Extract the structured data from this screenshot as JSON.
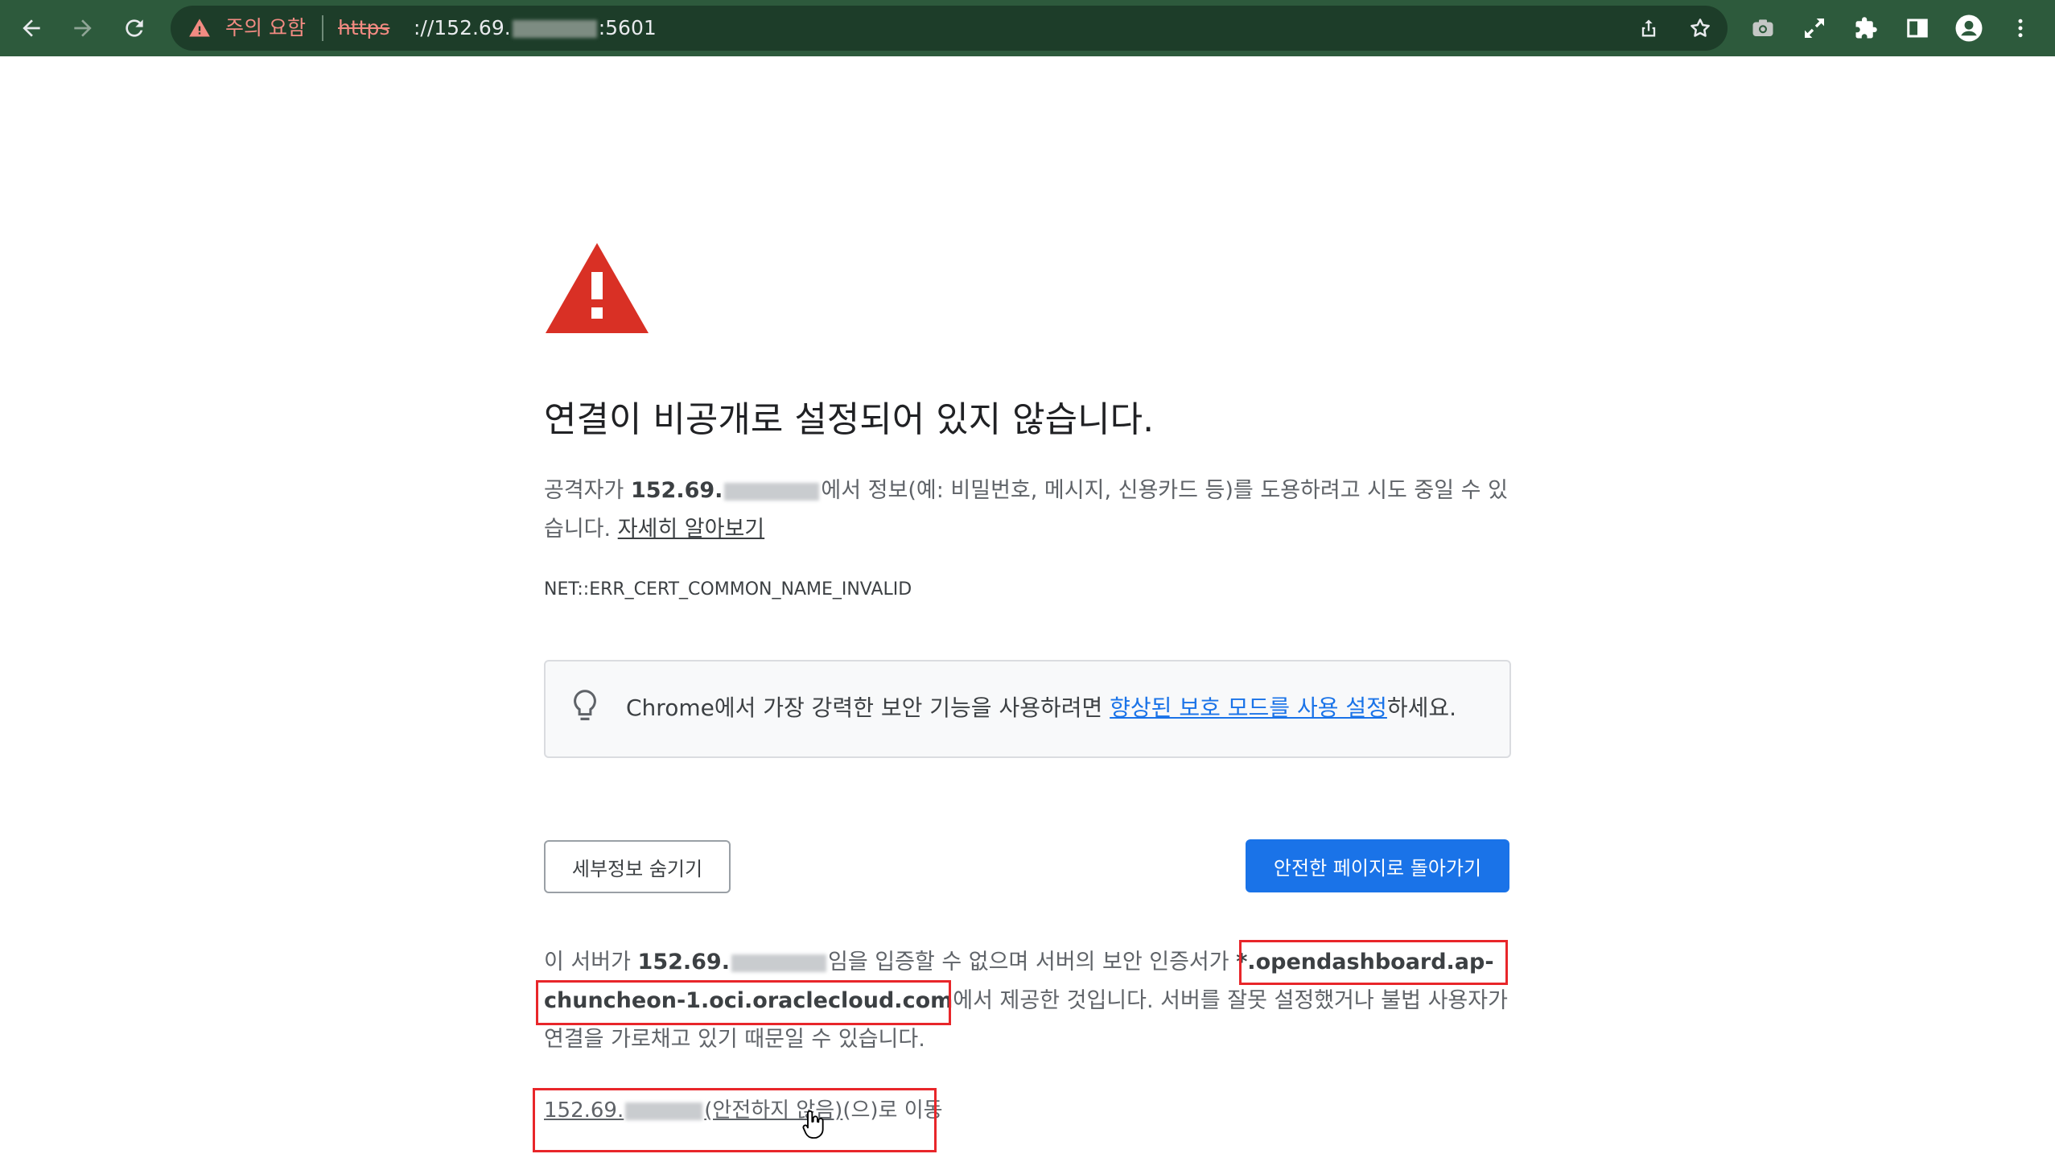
{
  "toolbar": {
    "back_icon": "arrow-left",
    "forward_icon": "arrow-right",
    "reload_icon": "reload",
    "security_label": "주의 요함",
    "url_scheme": "https",
    "url_prefix": "://152.69.",
    "url_suffix": ":5601",
    "right_icons": [
      "share-icon",
      "bookmark-star-icon",
      "camera-icon",
      "fullscreen-icon",
      "extensions-icon",
      "side-panel-icon",
      "profile-icon",
      "menu-icon"
    ]
  },
  "interstitial": {
    "heading": "연결이 비공개로 설정되어 있지 않습니다.",
    "body_pre": "공격자가 ",
    "body_host": "152.69.",
    "body_post": "에서 정보(예: 비밀번호, 메시지, 신용카드 등)를 도용하려고 시도 중일 수 있습니다. ",
    "learn_more": "자세히 알아보기",
    "error_code": "NET::ERR_CERT_COMMON_NAME_INVALID",
    "tip_pre": "Chrome에서 가장 강력한 보안 기능을 사용하려면 ",
    "tip_link": "향상된 보호 모드를 사용 설정",
    "tip_post": "하세요.",
    "hide_details_button": "세부정보 숨기기",
    "back_to_safety_button": "안전한 페이지로 돌아가기",
    "explain_pre": "이 서버가 ",
    "explain_host": "152.69.",
    "explain_mid": "임을 입증할 수 없으며 서버의 보안 인증서가 ",
    "explain_cert": "*.opendashboard.ap-chuncheon-1.oci.oraclecloud.com",
    "explain_post": "에서 제공한 것입니다. 서버를 잘못 설정했거나 불법 사용자가 연결을 가로채고 있기 때문일 수 있습니다.",
    "proceed_host": "152.69.",
    "proceed_unsafe": "(안전하지 않음)",
    "proceed_post": "(으)로 이동"
  },
  "colors": {
    "toolbar_bg": "#2d5a3c",
    "warning_red": "#d93025",
    "primary_blue": "#1a73e8",
    "annotation_red": "#e8262a"
  }
}
